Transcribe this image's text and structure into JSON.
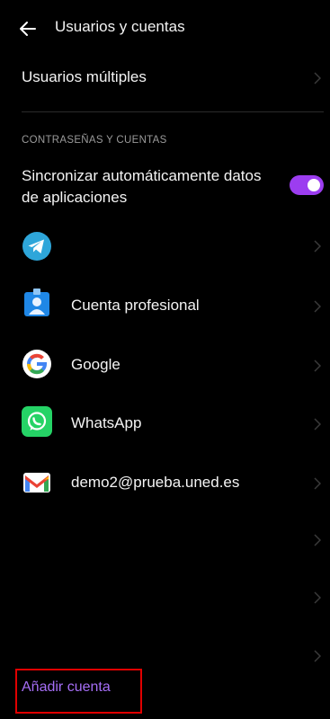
{
  "header": {
    "title": "Usuarios y cuentas"
  },
  "rows": {
    "multi_users": "Usuarios múltiples",
    "section_title": "CONTRASEÑAS Y CUENTAS",
    "sync_line1": "Sincronizar automáticamente datos",
    "sync_line2": "de aplicaciones",
    "sync_enabled": true
  },
  "accounts": [
    {
      "icon": "telegram-icon",
      "label": ""
    },
    {
      "icon": "work-profile-icon",
      "label": "Cuenta profesional"
    },
    {
      "icon": "google-icon",
      "label": "Google"
    },
    {
      "icon": "whatsapp-icon",
      "label": "WhatsApp"
    },
    {
      "icon": "gmail-icon",
      "label": "demo2@prueba.uned.es"
    }
  ],
  "footer": {
    "add_account": "Añadir cuenta"
  },
  "colors": {
    "accent": "#9c3df0",
    "link": "#a56ef5",
    "highlight": "#e00000"
  }
}
